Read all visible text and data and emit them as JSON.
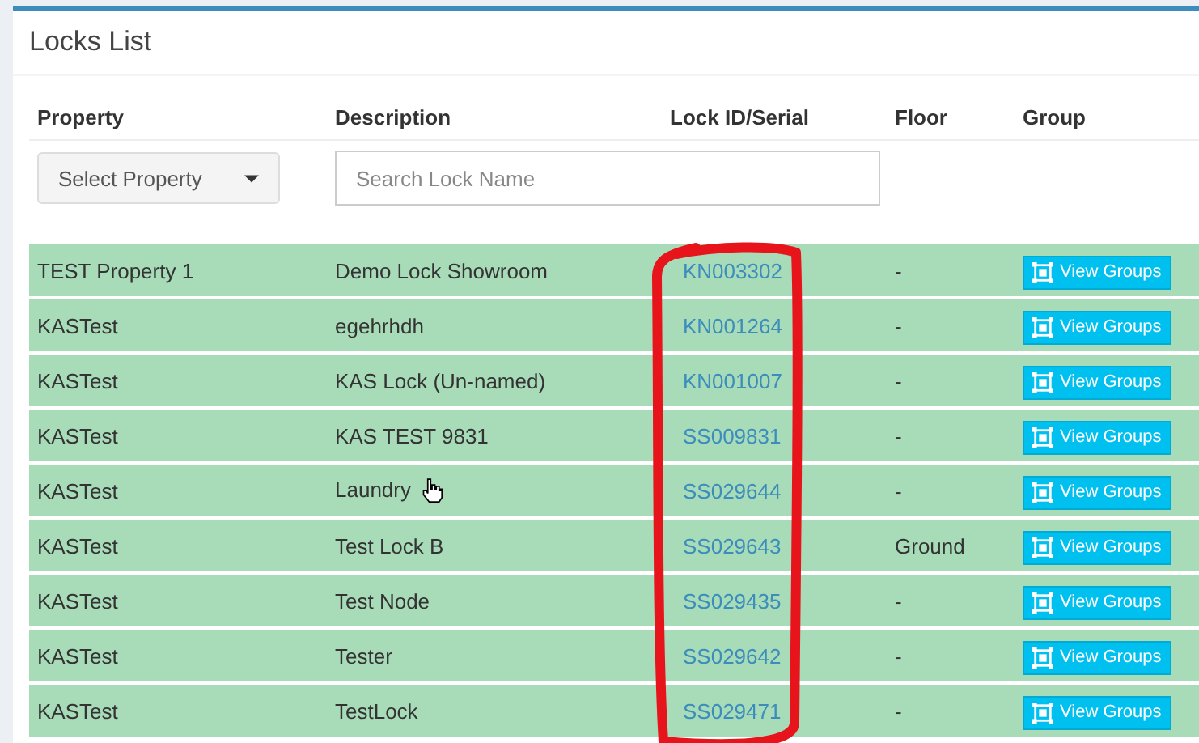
{
  "panel": {
    "title": "Locks List"
  },
  "columns": [
    "Property",
    "Description",
    "Lock ID/Serial",
    "Floor",
    "Group"
  ],
  "filters": {
    "property_select": {
      "value": "Select Property"
    },
    "lock_search": {
      "placeholder": "Search Lock Name"
    }
  },
  "rows": [
    {
      "property": "TEST Property 1",
      "description": "Demo Lock Showroom",
      "lock_id": "KN003302",
      "floor": "-",
      "group_button": "View Groups",
      "hovered": false
    },
    {
      "property": "KASTest",
      "description": "egehrhdh",
      "lock_id": "KN001264",
      "floor": "-",
      "group_button": "View Groups",
      "hovered": false
    },
    {
      "property": "KASTest",
      "description": "KAS Lock (Un-named)",
      "lock_id": "KN001007",
      "floor": "-",
      "group_button": "View Groups",
      "hovered": false
    },
    {
      "property": "KASTest",
      "description": "KAS TEST 9831",
      "lock_id": "SS009831",
      "floor": "-",
      "group_button": "View Groups",
      "hovered": false
    },
    {
      "property": "KASTest",
      "description": "Laundry",
      "lock_id": "SS029644",
      "floor": "-",
      "group_button": "View Groups",
      "hovered": true
    },
    {
      "property": "KASTest",
      "description": "Test Lock B",
      "lock_id": "SS029643",
      "floor": "Ground",
      "group_button": "View Groups",
      "hovered": false
    },
    {
      "property": "KASTest",
      "description": "Test Node",
      "lock_id": "SS029435",
      "floor": "-",
      "group_button": "View Groups",
      "hovered": false
    },
    {
      "property": "KASTest",
      "description": "Tester",
      "lock_id": "SS029642",
      "floor": "-",
      "group_button": "View Groups",
      "hovered": false
    },
    {
      "property": "KASTest",
      "description": "TestLock",
      "lock_id": "SS029471",
      "floor": "-",
      "group_button": "View Groups",
      "hovered": false
    }
  ]
}
